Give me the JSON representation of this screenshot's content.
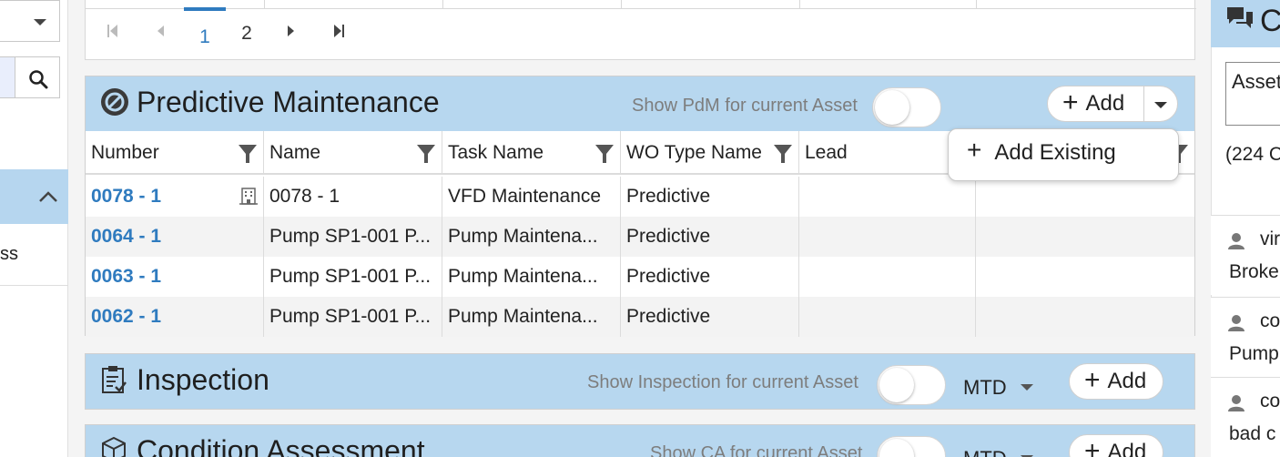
{
  "left_panel": {
    "select_value": "",
    "search_icon": "search-icon",
    "partial_text": "ss"
  },
  "pager": {
    "pages": [
      "1",
      "2"
    ],
    "active_page": "1"
  },
  "pdm": {
    "title": "Predictive Maintenance",
    "toggle_label": "Show PdM for current Asset",
    "add_label": "Add",
    "menu": {
      "add_existing": "Add Existing"
    },
    "columns": [
      "Number",
      "Name",
      "Task Name",
      "WO Type Name",
      "Lead"
    ],
    "rows": [
      {
        "number": "0078 - 1",
        "name": "0078 - 1",
        "task": "VFD Maintenance",
        "wo_type": "Predictive",
        "lead": ""
      },
      {
        "number": "0064 - 1",
        "name": "Pump SP1-001 P...",
        "task": "Pump Maintena...",
        "wo_type": "Predictive",
        "lead": ""
      },
      {
        "number": "0063 - 1",
        "name": "Pump SP1-001 P...",
        "task": "Pump Maintena...",
        "wo_type": "Predictive",
        "lead": ""
      },
      {
        "number": "0062 - 1",
        "name": "Pump SP1-001 P...",
        "task": "Pump Maintena...",
        "wo_type": "Predictive",
        "lead": ""
      }
    ]
  },
  "inspection": {
    "title": "Inspection",
    "toggle_label": "Show Inspection for current Asset",
    "period": "MTD",
    "add_label": "Add"
  },
  "condition": {
    "title": "Condition Assessment",
    "toggle_label": "Show CA for current Asset",
    "period": "MTD",
    "add_label": "Add"
  },
  "right_panel": {
    "title": "C",
    "input_value": "Asset",
    "count": "(224 C",
    "items": [
      {
        "user": "vir",
        "message": "Broke"
      },
      {
        "user": "co",
        "message": "Pump"
      },
      {
        "user": "co",
        "message": "bad c"
      }
    ]
  },
  "colors": {
    "header_blue": "#b7d7ef",
    "link_blue": "#2f7bbf"
  }
}
